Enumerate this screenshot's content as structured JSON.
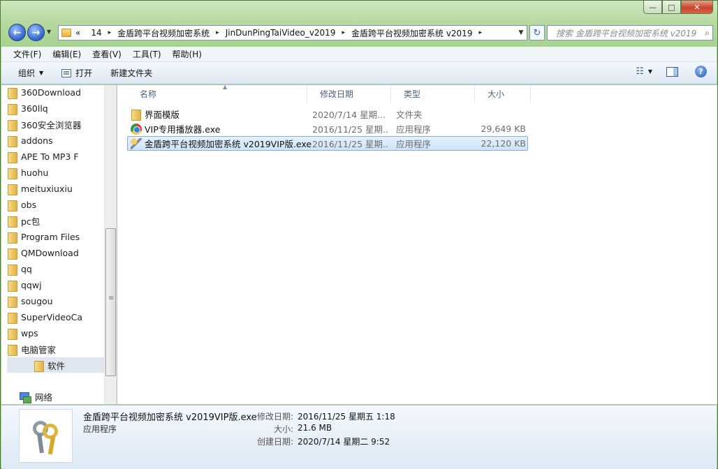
{
  "window": {
    "caption_buttons": [
      "—",
      "□",
      "✕"
    ]
  },
  "nav": {
    "back_icon": "←",
    "forward_icon": "→",
    "history_dropdown": "▼",
    "breadcrumb_overflow": "«",
    "breadcrumbs": [
      "14",
      "金盾跨平台视频加密系统",
      "JinDunPingTaiVideo_v2019",
      "金盾跨平台视频加密系统 v2019"
    ],
    "separator": "▸",
    "address_dropdown": "▼",
    "refresh_icon": "↻",
    "search_placeholder": "搜索 金盾跨平台视频加密系统 v2019",
    "search_icon": "⌕"
  },
  "menubar": {
    "items": [
      "文件(F)",
      "编辑(E)",
      "查看(V)",
      "工具(T)",
      "帮助(H)"
    ]
  },
  "toolbar": {
    "organize": "组织",
    "open": "打开",
    "new_folder": "新建文件夹",
    "caret": "▼",
    "view_icon": "☷"
  },
  "sidebar": {
    "items": [
      {
        "label": "360Download"
      },
      {
        "label": "360llq"
      },
      {
        "label": "360安全浏览器"
      },
      {
        "label": "addons"
      },
      {
        "label": "APE To MP3 F"
      },
      {
        "label": "huohu"
      },
      {
        "label": "meituxiuxiu"
      },
      {
        "label": "obs"
      },
      {
        "label": "pc包"
      },
      {
        "label": "Program Files"
      },
      {
        "label": "QMDownload"
      },
      {
        "label": "qq"
      },
      {
        "label": "qqwj"
      },
      {
        "label": "sougou"
      },
      {
        "label": "SuperVideoCa"
      },
      {
        "label": "wps"
      },
      {
        "label": "电脑管家"
      },
      {
        "label": "软件"
      }
    ],
    "selected_index": 17,
    "network": "网络"
  },
  "filelist": {
    "columns": {
      "name": "名称",
      "date": "修改日期",
      "type": "类型",
      "size": "大小"
    },
    "sort_arrow": "▲",
    "rows": [
      {
        "name": "界面模版",
        "date": "2020/7/14 星期...",
        "type": "文件夹",
        "size": "",
        "icon": "folder-icon"
      },
      {
        "name": "VIP专用播放器.exe",
        "date": "2016/11/25 星期...",
        "type": "应用程序",
        "size": "29,649 KB",
        "icon": "player-app-icon"
      },
      {
        "name": "金盾跨平台视频加密系统 v2019VIP版.exe",
        "date": "2016/11/25 星期...",
        "type": "应用程序",
        "size": "22,120 KB",
        "icon": "keys-app-icon"
      }
    ],
    "selected_index": 2
  },
  "details": {
    "name": "金盾跨平台视频加密系统 v2019VIP版.exe",
    "type": "应用程序",
    "modified_label": "修改日期:",
    "modified_value": "2016/11/25 星期五 1:18",
    "size_label": "大小:",
    "size_value": "21.6 MB",
    "created_label": "创建日期:",
    "created_value": "2020/7/14 星期二 9:52"
  },
  "colors": {
    "selection": "#cfe4f9",
    "window_frame": "#a9d290"
  }
}
